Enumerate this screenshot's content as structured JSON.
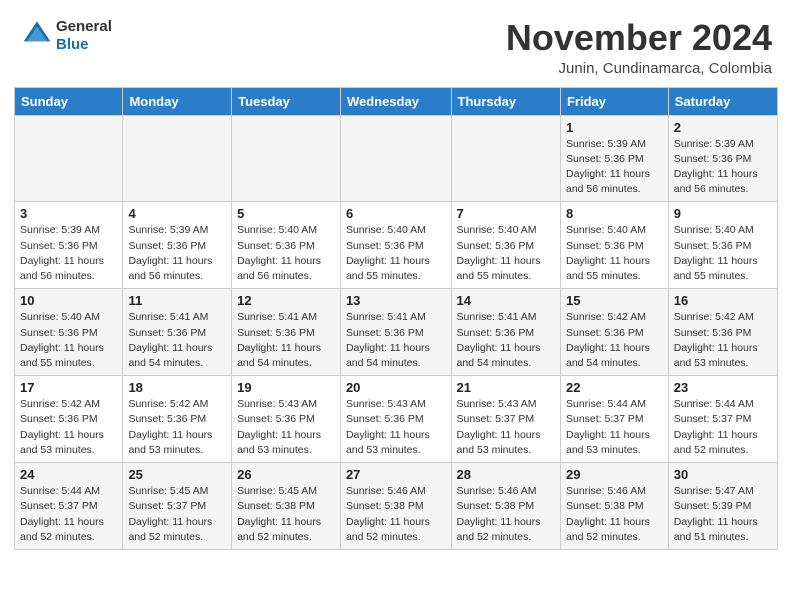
{
  "header": {
    "logo_general": "General",
    "logo_blue": "Blue",
    "month_title": "November 2024",
    "location": "Junin, Cundinamarca, Colombia"
  },
  "days_of_week": [
    "Sunday",
    "Monday",
    "Tuesday",
    "Wednesday",
    "Thursday",
    "Friday",
    "Saturday"
  ],
  "weeks": [
    [
      {
        "day": "",
        "info": ""
      },
      {
        "day": "",
        "info": ""
      },
      {
        "day": "",
        "info": ""
      },
      {
        "day": "",
        "info": ""
      },
      {
        "day": "",
        "info": ""
      },
      {
        "day": "1",
        "info": "Sunrise: 5:39 AM\nSunset: 5:36 PM\nDaylight: 11 hours\nand 56 minutes."
      },
      {
        "day": "2",
        "info": "Sunrise: 5:39 AM\nSunset: 5:36 PM\nDaylight: 11 hours\nand 56 minutes."
      }
    ],
    [
      {
        "day": "3",
        "info": "Sunrise: 5:39 AM\nSunset: 5:36 PM\nDaylight: 11 hours\nand 56 minutes."
      },
      {
        "day": "4",
        "info": "Sunrise: 5:39 AM\nSunset: 5:36 PM\nDaylight: 11 hours\nand 56 minutes."
      },
      {
        "day": "5",
        "info": "Sunrise: 5:40 AM\nSunset: 5:36 PM\nDaylight: 11 hours\nand 56 minutes."
      },
      {
        "day": "6",
        "info": "Sunrise: 5:40 AM\nSunset: 5:36 PM\nDaylight: 11 hours\nand 55 minutes."
      },
      {
        "day": "7",
        "info": "Sunrise: 5:40 AM\nSunset: 5:36 PM\nDaylight: 11 hours\nand 55 minutes."
      },
      {
        "day": "8",
        "info": "Sunrise: 5:40 AM\nSunset: 5:36 PM\nDaylight: 11 hours\nand 55 minutes."
      },
      {
        "day": "9",
        "info": "Sunrise: 5:40 AM\nSunset: 5:36 PM\nDaylight: 11 hours\nand 55 minutes."
      }
    ],
    [
      {
        "day": "10",
        "info": "Sunrise: 5:40 AM\nSunset: 5:36 PM\nDaylight: 11 hours\nand 55 minutes."
      },
      {
        "day": "11",
        "info": "Sunrise: 5:41 AM\nSunset: 5:36 PM\nDaylight: 11 hours\nand 54 minutes."
      },
      {
        "day": "12",
        "info": "Sunrise: 5:41 AM\nSunset: 5:36 PM\nDaylight: 11 hours\nand 54 minutes."
      },
      {
        "day": "13",
        "info": "Sunrise: 5:41 AM\nSunset: 5:36 PM\nDaylight: 11 hours\nand 54 minutes."
      },
      {
        "day": "14",
        "info": "Sunrise: 5:41 AM\nSunset: 5:36 PM\nDaylight: 11 hours\nand 54 minutes."
      },
      {
        "day": "15",
        "info": "Sunrise: 5:42 AM\nSunset: 5:36 PM\nDaylight: 11 hours\nand 54 minutes."
      },
      {
        "day": "16",
        "info": "Sunrise: 5:42 AM\nSunset: 5:36 PM\nDaylight: 11 hours\nand 53 minutes."
      }
    ],
    [
      {
        "day": "17",
        "info": "Sunrise: 5:42 AM\nSunset: 5:36 PM\nDaylight: 11 hours\nand 53 minutes."
      },
      {
        "day": "18",
        "info": "Sunrise: 5:42 AM\nSunset: 5:36 PM\nDaylight: 11 hours\nand 53 minutes."
      },
      {
        "day": "19",
        "info": "Sunrise: 5:43 AM\nSunset: 5:36 PM\nDaylight: 11 hours\nand 53 minutes."
      },
      {
        "day": "20",
        "info": "Sunrise: 5:43 AM\nSunset: 5:36 PM\nDaylight: 11 hours\nand 53 minutes."
      },
      {
        "day": "21",
        "info": "Sunrise: 5:43 AM\nSunset: 5:37 PM\nDaylight: 11 hours\nand 53 minutes."
      },
      {
        "day": "22",
        "info": "Sunrise: 5:44 AM\nSunset: 5:37 PM\nDaylight: 11 hours\nand 53 minutes."
      },
      {
        "day": "23",
        "info": "Sunrise: 5:44 AM\nSunset: 5:37 PM\nDaylight: 11 hours\nand 52 minutes."
      }
    ],
    [
      {
        "day": "24",
        "info": "Sunrise: 5:44 AM\nSunset: 5:37 PM\nDaylight: 11 hours\nand 52 minutes."
      },
      {
        "day": "25",
        "info": "Sunrise: 5:45 AM\nSunset: 5:37 PM\nDaylight: 11 hours\nand 52 minutes."
      },
      {
        "day": "26",
        "info": "Sunrise: 5:45 AM\nSunset: 5:38 PM\nDaylight: 11 hours\nand 52 minutes."
      },
      {
        "day": "27",
        "info": "Sunrise: 5:46 AM\nSunset: 5:38 PM\nDaylight: 11 hours\nand 52 minutes."
      },
      {
        "day": "28",
        "info": "Sunrise: 5:46 AM\nSunset: 5:38 PM\nDaylight: 11 hours\nand 52 minutes."
      },
      {
        "day": "29",
        "info": "Sunrise: 5:46 AM\nSunset: 5:38 PM\nDaylight: 11 hours\nand 52 minutes."
      },
      {
        "day": "30",
        "info": "Sunrise: 5:47 AM\nSunset: 5:39 PM\nDaylight: 11 hours\nand 51 minutes."
      }
    ]
  ]
}
